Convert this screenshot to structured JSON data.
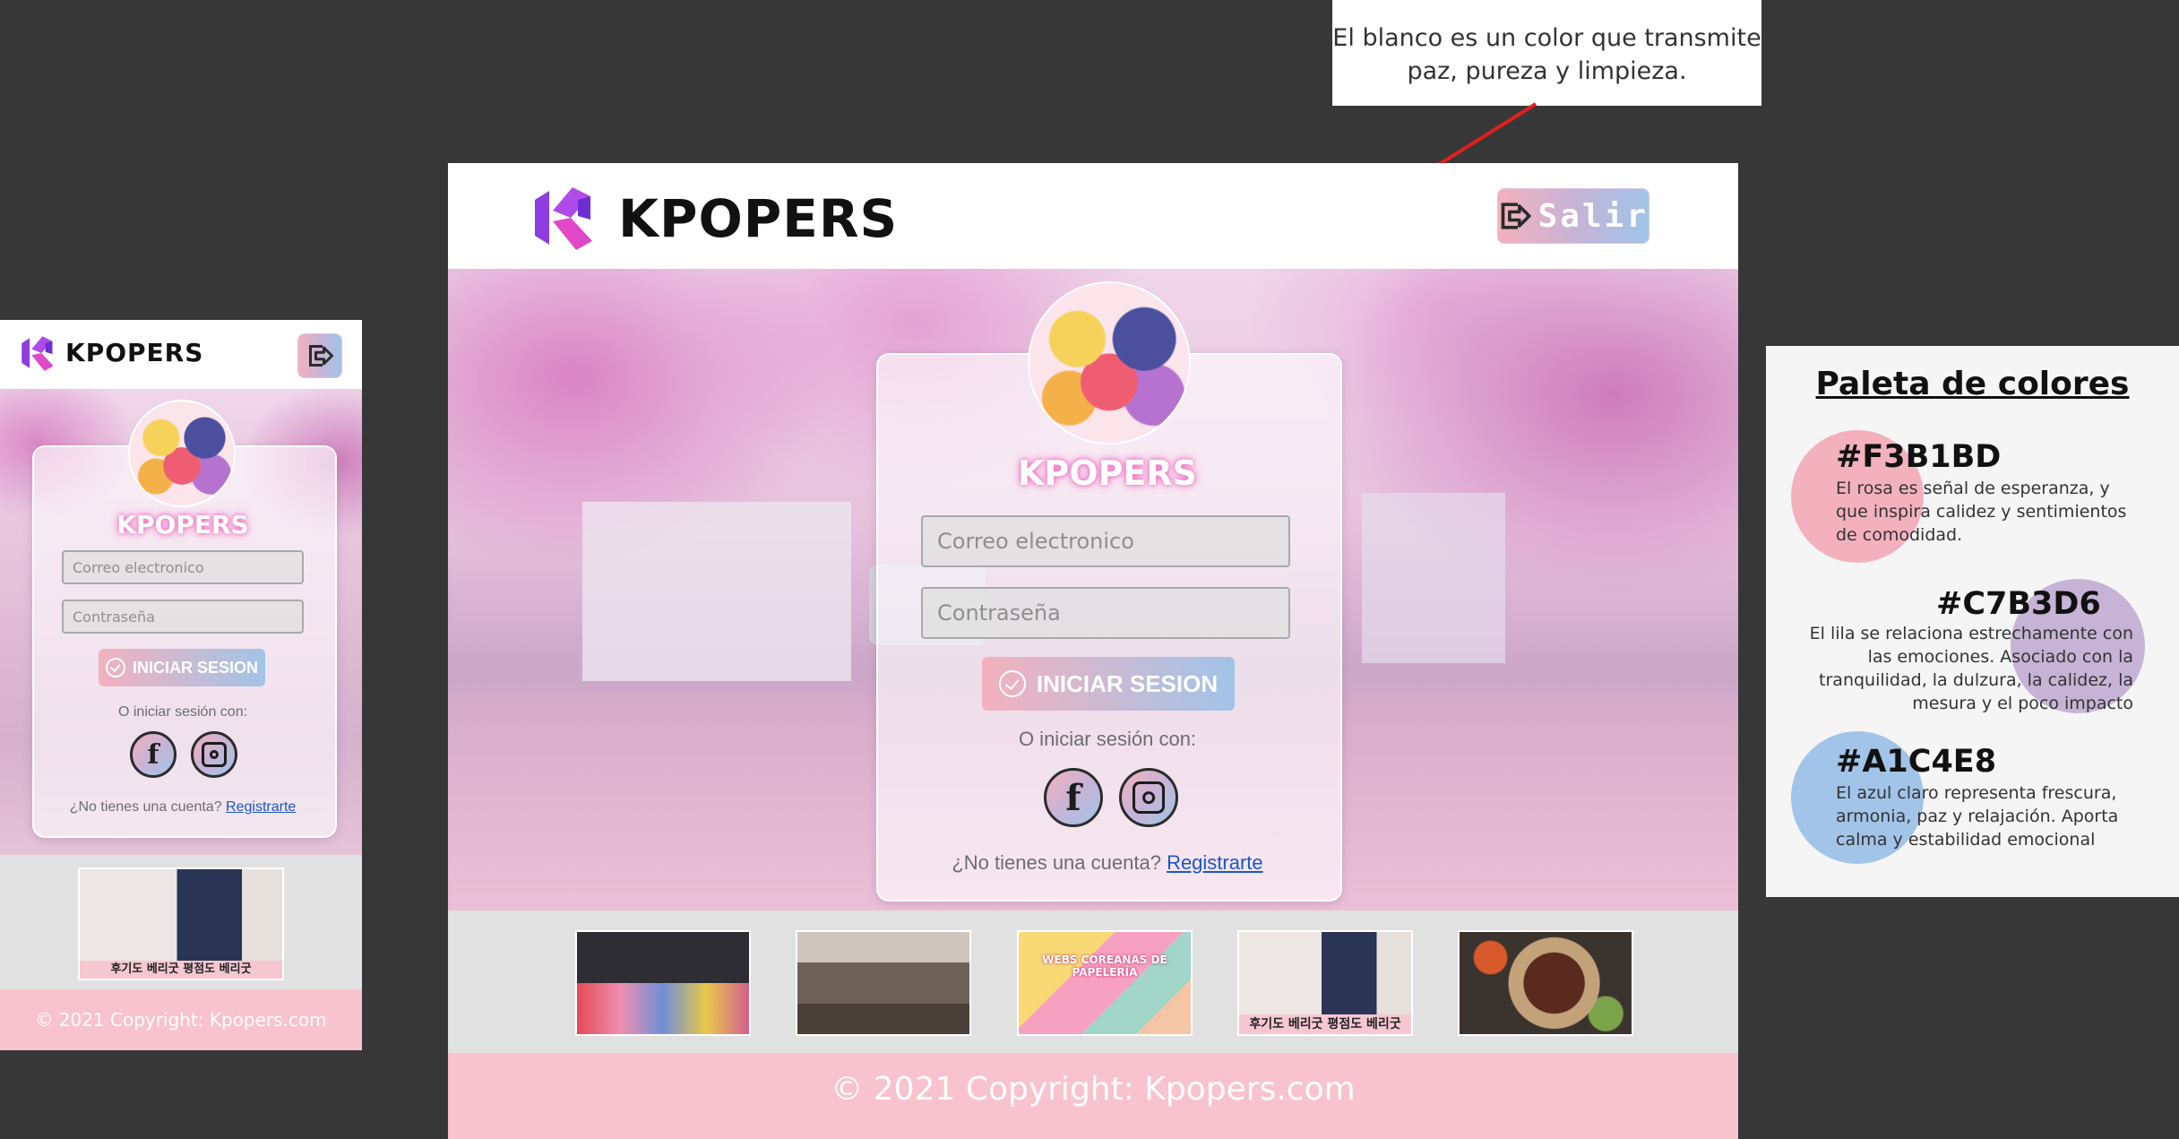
{
  "annotation": {
    "text": "El blanco es un color que transmite paz, pureza y limpieza."
  },
  "desktop": {
    "header": {
      "brand": "KPOPERS",
      "exit_label": "Salir"
    },
    "login": {
      "brand": "KPOPERS",
      "email_placeholder": "Correo electronico",
      "password_placeholder": "Contraseña",
      "login_button": "INICIAR SESION",
      "alt_login_text": "O iniciar sesión con:",
      "signup_prompt": "¿No tienes una cuenta?",
      "signup_link": "Registrarte"
    },
    "thumbnails": [
      {
        "name": "kpop-groups"
      },
      {
        "name": "korean-street"
      },
      {
        "name": "webs-coreanas",
        "caption": "WEBS COREANAS DE PAPELERÍA"
      },
      {
        "name": "korean-fashion",
        "caption": "후기도 베리굿 평점도 베리굿"
      },
      {
        "name": "korean-bbq"
      }
    ],
    "footer": "© 2021 Copyright: Kpopers.com"
  },
  "mobile": {
    "header": {
      "brand": "KPOPERS"
    },
    "login": {
      "brand": "KPOPERS",
      "email_placeholder": "Correo electronico",
      "password_placeholder": "Contraseña",
      "login_button": "INICIAR SESION",
      "alt_login_text": "O iniciar sesión con:",
      "signup_prompt": "¿No tienes una cuenta?",
      "signup_link": "Registrarte"
    },
    "thumbnail_caption": "후기도 베리굿 평점도 베리굿",
    "footer": "© 2021 Copyright: Kpopers.com"
  },
  "palette": {
    "title": "Paleta de colores",
    "colors": [
      {
        "hex": "#F3B1BD",
        "description": "El rosa es señal de esperanza, y que inspira calidez y sentimientos de comodidad."
      },
      {
        "hex": "#C7B3D6",
        "description": "El lila se relaciona estrechamente con las emociones. Asociado con la tranquilidad, la dulzura, la calidez, la mesura y el poco impacto"
      },
      {
        "hex": "#A1C4E8",
        "description": "El azul claro representa frescura, armonia, paz y relajación. Aporta calma y estabilidad emocional"
      }
    ]
  },
  "colors": {
    "pink": "#F3B1BD",
    "lilac": "#C7B3D6",
    "light_blue": "#A1C4E8",
    "footer_pink": "#F8C3CC",
    "arrow_red": "#e0201c"
  }
}
